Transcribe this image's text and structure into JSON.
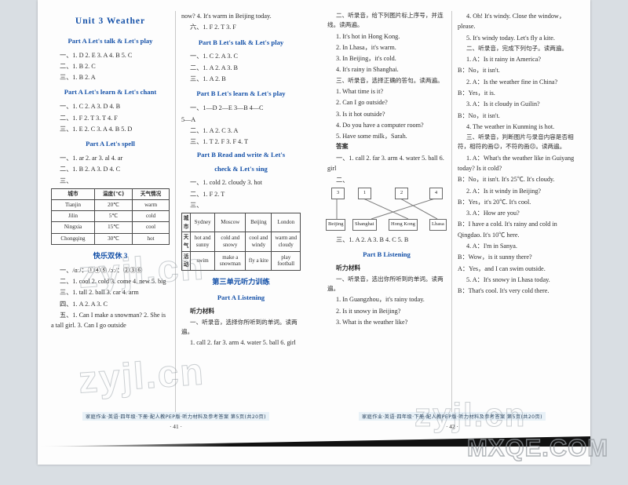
{
  "document": {
    "watermarks": [
      "zyjl.cn",
      "MXQE.COM"
    ],
    "left_page": {
      "footer_text": "家庭作业·英语·四年级·下册·配人教PEP版·听力材料及参考答案  第5页(共20页)",
      "page_number": "· 41 ·"
    },
    "right_page": {
      "footer_text": "家庭作业·英语·四年级·下册·配人教PEP版·听力材料及参考答案  第5页(共20页)",
      "page_number": "· 42 ·"
    }
  },
  "col1": {
    "unit_title": "Unit 3   Weather",
    "sec_a_talk": "Part A   Let's talk & Let's play",
    "a_talk_lines": [
      "一、1. D  2. E  3. A  4. B  5. C",
      "二、1. B  2. C",
      "三、1. B  2. A"
    ],
    "sec_a_learn": "Part A   Let's learn & Let's chant",
    "a_learn_lines": [
      "一、1. C   2. A   3. D   4. B",
      "二、1. F   2. T   3. T   4. F",
      "三、1. E   2. C   3. A   4. B   5. D"
    ],
    "sec_a_spell": "Part A   Let's spell",
    "a_spell_lines": [
      "一、1. ar   2. ar   3. al   4. ar",
      "二、1. B   2. A   3. D   4. C",
      "三、"
    ],
    "table": {
      "headers": [
        "城市",
        "温度(℃)",
        "天气情况"
      ],
      "rows": [
        [
          "Tianjin",
          "20℃",
          "warm"
        ],
        [
          "Jilin",
          "5℃",
          "cold"
        ],
        [
          "Ningxia",
          "15℃",
          "cool"
        ],
        [
          "Chongqing",
          "30℃",
          "hot"
        ]
      ]
    },
    "happy_title": "快乐双休 3",
    "happy_lines": [
      "一、/ɑː/：①④⑤   /ɔː/：②③⑥",
      "二、1. cool   2. cold   3. come   4. new   5. big",
      "三、1. tall   2. ball   3. car   4. arm",
      "四、1. A   2. A   3. C",
      "五、1. Can I make a snowman?  2. She is a tall girl.   3. Can I go outside"
    ]
  },
  "col2": {
    "top_lines": [
      "now?    4. It's warm in Beijing today.",
      "六、1. F   2. T   3. F"
    ],
    "sec_b_talk": "Part B   Let's talk & Let's play",
    "b_talk_lines": [
      "一、1. C   2. A   3. C",
      "二、1. A   2. A   3. B",
      "三、1. A   2. B"
    ],
    "sec_b_learn": "Part B   Let's learn & Let's play",
    "b_learn_lines": [
      "一、1—D  2—E  3—B  4—C",
      "5—A",
      "二、1. A   2. C   3. A",
      "三、1. T   2. F   3. F   4. T"
    ],
    "sec_b_read": "Part B   Read and write & Let's",
    "sec_b_read2": "check & Let's sing",
    "b_read_lines": [
      "一、1. cold   2. cloudy   3. hot",
      "二、1. F   2. T",
      "三、"
    ],
    "table": {
      "row_headers": [
        "城市",
        "天气",
        "活动"
      ],
      "cities": [
        "Sydney",
        "Moscow",
        "Beijing",
        "London"
      ],
      "weather": [
        "hot and sunny",
        "cold and snowy",
        "cool and windy",
        "warm and cloudy"
      ],
      "activity": [
        "swim",
        "make a snowman",
        "fly a kite",
        "play football"
      ]
    },
    "unit_listening_title": "第三单元听力训练",
    "part_a_listening": "Part A   Listening",
    "material_label": "听力材料",
    "q1_stem": "一、听录音，选择你所听到的单词。读两遍。",
    "q1_items": "1. call   2. far   3. arm   4. water   5. ball   6. girl"
  },
  "col3": {
    "q2_stem": "二、听录音，给下列图片标上序号，并连线。读两遍。",
    "q2_items": [
      "1. It's hot in Hong Kong.",
      "2. In Lhasa，it's warm.",
      "3. In Beijing，it's cold.",
      "4. It's rainy in Shanghai."
    ],
    "q3_stem": "三、听录音，选择正确的答句。读两遍。",
    "q3_items": [
      "1. What time is it?",
      "2. Can I go outside?",
      "3. Is it hot outside?",
      "4. Do you have a computer room?",
      "5. Have some milk，Sarah."
    ],
    "answers_label": "答案",
    "ans1": "一、1. call   2. far   3. arm   4. water   5. ball   6. girl",
    "ans2_label": "二、",
    "match": {
      "numbers": [
        "3",
        "1",
        "2",
        "4"
      ],
      "cities": [
        "Beijing",
        "Shanghai",
        "Hong Kong",
        "Lhasa"
      ],
      "links": [
        [
          0,
          0
        ],
        [
          1,
          2
        ],
        [
          2,
          3
        ],
        [
          3,
          1
        ]
      ]
    },
    "ans3": "三、1. A   2. A   3. B   4. C   5. B",
    "part_b_listening": "Part B   Listening",
    "material_label": "听力材料",
    "b_q1_stem": "一、听录音，选出你所听到的单词。读两遍。",
    "b_q1_items": [
      "1. In Guangzhou，it's rainy today.",
      "2. Is it snowy in Beijing?",
      "3. What is the weather like?"
    ]
  },
  "col4": {
    "cont_items": [
      "4. Oh! It's windy. Close the window，please.",
      "5. It's windy today. Let's fly a kite."
    ],
    "b_q2_stem": "二、听录音，完成下列句子。读两遍。",
    "b_q2_items": [
      "1. A：Is it rainy in America?",
      "B：No，it isn't.",
      "2. A：Is the weather fine in China?",
      "B：Yes，it is.",
      "3. A：Is it cloudy in Guilin?",
      "B：No，it isn't.",
      "4. The weather in Kunming is hot."
    ],
    "b_q3_stem": "三、听录音，判断图片与录音内容是否相符，相符的画☺，不符的画☹。读两遍。",
    "b_q3_items": [
      "1. A：What's the weather like in Guiyang today? Is it cold?",
      "B：No，it isn't. It's 25℃. It's cloudy.",
      "2. A：Is it windy in Beijing?",
      "B：Yes，it's 20℃. It's cool.",
      "3. A：How are you?",
      "B：I have a cold. It's rainy and cold in Qingdao. It's 10℃ here.",
      "4. A：I'm in Sanya.",
      "B：Wow，is it sunny there?",
      "A：Yes，and I can swim outside.",
      "5. A：It's snowy in Lhasa today.",
      "B：That's cool. It's very cold there."
    ]
  }
}
